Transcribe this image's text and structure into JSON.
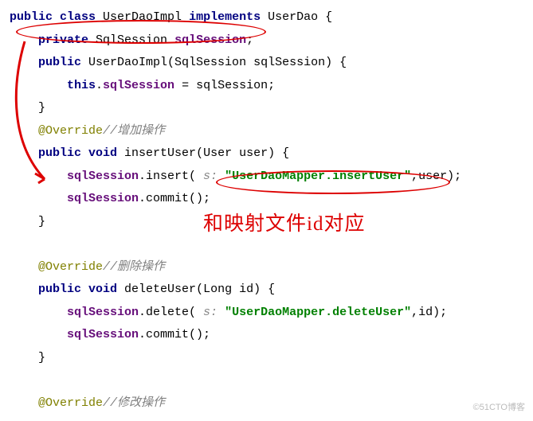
{
  "code": {
    "l1_kw1": "public class",
    "l1_name": " UserDaoImpl ",
    "l1_kw2": "implements",
    "l1_after": " UserDao {",
    "l2_kw": "private",
    "l2_type": " SqlSession ",
    "l2_field": "sqlSession",
    "l2_end": ";",
    "l3_kw": "public",
    "l3_after": " UserDaoImpl(SqlSession sqlSession) {",
    "l4_this": "this",
    "l4_dot": ".",
    "l4_field": "sqlSession",
    "l4_rest": " = sqlSession;",
    "l5": "}",
    "l6_ann": "@Override",
    "l6_cmt": "//增加操作",
    "l7_kw": "public void",
    "l7_after": " insertUser(User user) {",
    "l8_obj": "sqlSession",
    "l8_call": ".insert( ",
    "l8_hint": "s: ",
    "l8_str": "\"UserDaoMapper.insertUser\"",
    "l8_end": ",user);",
    "l9_obj": "sqlSession",
    "l9_rest": ".commit();",
    "l10": "}",
    "l12_ann": "@Override",
    "l12_cmt": "//删除操作",
    "l13_kw": "public void",
    "l13_after": " deleteUser(Long id) {",
    "l14_obj": "sqlSession",
    "l14_call": ".delete( ",
    "l14_hint": "s: ",
    "l14_str": "\"UserDaoMapper.deleteUser\"",
    "l14_end": ",id);",
    "l15_obj": "sqlSession",
    "l15_rest": ".commit();",
    "l16": "}",
    "l18_ann": "@Override",
    "l18_cmt": "//修改操作"
  },
  "annotation": "和映射文件id对应",
  "watermark": "©51CTO博客"
}
